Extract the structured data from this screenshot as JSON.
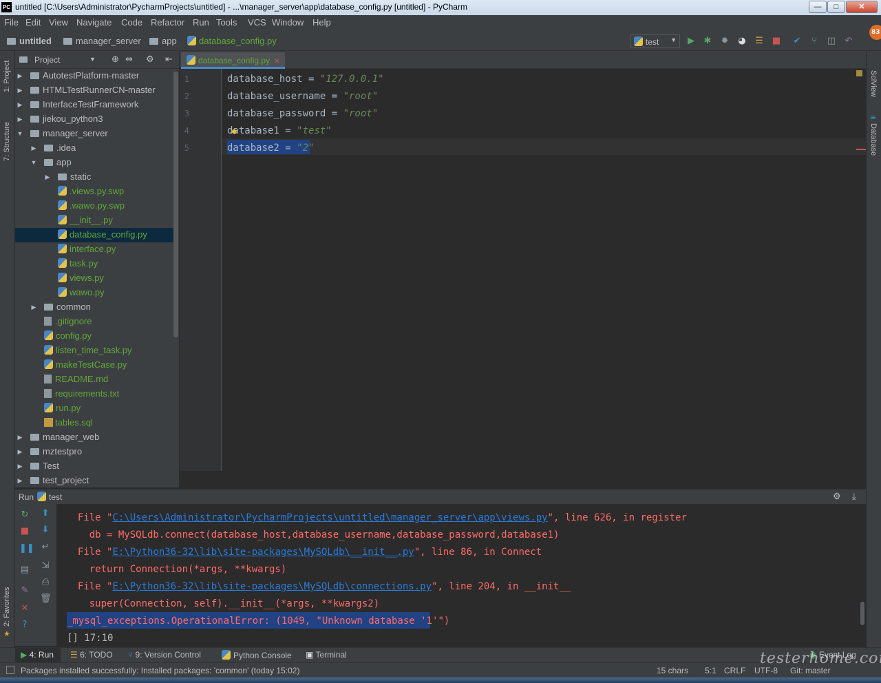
{
  "window": {
    "title": "untitled [C:\\Users\\Administrator\\PycharmProjects\\untitled] - ...\\manager_server\\app\\database_config.py [untitled] - PyCharm",
    "app_icon": "PC"
  },
  "menu": [
    "File",
    "Edit",
    "View",
    "Navigate",
    "Code",
    "Refactor",
    "Run",
    "Tools",
    "VCS",
    "Window",
    "Help"
  ],
  "breadcrumb": [
    "untitled",
    "manager_server",
    "app",
    "database_config.py"
  ],
  "run_config": "test",
  "badge": "83",
  "project_panel": {
    "title": "Project"
  },
  "tree": [
    {
      "label": "AutotestPlatform-master",
      "depth": 0,
      "type": "folder",
      "arrow": "right"
    },
    {
      "label": "HTMLTestRunnerCN-master",
      "depth": 0,
      "type": "folder",
      "arrow": "right"
    },
    {
      "label": "InterfaceTestFramework",
      "depth": 0,
      "type": "folder",
      "arrow": "right"
    },
    {
      "label": "jiekou_python3",
      "depth": 0,
      "type": "folder",
      "arrow": "right"
    },
    {
      "label": "manager_server",
      "depth": 0,
      "type": "folder",
      "arrow": "down"
    },
    {
      "label": ".idea",
      "depth": 1,
      "type": "folder",
      "arrow": "right"
    },
    {
      "label": "app",
      "depth": 1,
      "type": "folder",
      "arrow": "down"
    },
    {
      "label": "static",
      "depth": 2,
      "type": "folder",
      "arrow": "right"
    },
    {
      "label": ".views.py.swp",
      "depth": 2,
      "type": "py",
      "arrow": ""
    },
    {
      "label": ".wawo.py.swp",
      "depth": 2,
      "type": "py",
      "arrow": ""
    },
    {
      "label": "__init__.py",
      "depth": 2,
      "type": "py",
      "arrow": ""
    },
    {
      "label": "database_config.py",
      "depth": 2,
      "type": "py",
      "arrow": "",
      "selected": true
    },
    {
      "label": "interface.py",
      "depth": 2,
      "type": "py",
      "arrow": ""
    },
    {
      "label": "task.py",
      "depth": 2,
      "type": "py",
      "arrow": ""
    },
    {
      "label": "views.py",
      "depth": 2,
      "type": "py",
      "arrow": ""
    },
    {
      "label": "wawo.py",
      "depth": 2,
      "type": "py",
      "arrow": ""
    },
    {
      "label": "common",
      "depth": 1,
      "type": "folder",
      "arrow": "right"
    },
    {
      "label": ".gitignore",
      "depth": 1,
      "type": "file",
      "arrow": ""
    },
    {
      "label": "config.py",
      "depth": 1,
      "type": "py",
      "arrow": ""
    },
    {
      "label": "listen_time_task.py",
      "depth": 1,
      "type": "py",
      "arrow": ""
    },
    {
      "label": "makeTestCase.py",
      "depth": 1,
      "type": "py",
      "arrow": ""
    },
    {
      "label": "README.md",
      "depth": 1,
      "type": "file",
      "arrow": ""
    },
    {
      "label": "requirements.txt",
      "depth": 1,
      "type": "file",
      "arrow": ""
    },
    {
      "label": "run.py",
      "depth": 1,
      "type": "py",
      "arrow": ""
    },
    {
      "label": "tables.sql",
      "depth": 1,
      "type": "sql",
      "arrow": ""
    },
    {
      "label": "manager_web",
      "depth": 0,
      "type": "folder",
      "arrow": "right"
    },
    {
      "label": "mztestpro",
      "depth": 0,
      "type": "folder",
      "arrow": "right"
    },
    {
      "label": "Test",
      "depth": 0,
      "type": "folder",
      "arrow": "right"
    },
    {
      "label": "test_project",
      "depth": 0,
      "type": "folder",
      "arrow": "right"
    }
  ],
  "editor": {
    "tab": "database_config.py",
    "lines": [
      {
        "num": "1",
        "code": "database_host = ",
        "str": "\"127.0.0.1\""
      },
      {
        "num": "2",
        "code": "database_username = ",
        "str": "\"root\""
      },
      {
        "num": "3",
        "code": "database_password = ",
        "str": "\"root\""
      },
      {
        "num": "4",
        "code": "database1 = ",
        "str": "\"test\""
      },
      {
        "num": "5",
        "code": "database2 = ",
        "str": "\"2\""
      }
    ]
  },
  "run_panel": {
    "label": "Run",
    "config": "test",
    "output": [
      {
        "pre": "  File \"",
        "link": "C:\\Users\\Administrator\\PycharmProjects\\untitled\\manager_server\\app\\views.py",
        "post": "\", line 626, in register"
      },
      {
        "pre": "    db = MySQLdb.connect(database_host,database_username,database_password,database1)",
        "link": "",
        "post": ""
      },
      {
        "pre": "  File \"",
        "link": "E:\\Python36-32\\lib\\site-packages\\MySQLdb\\__init__.py",
        "post": "\", line 86, in Connect"
      },
      {
        "pre": "    return Connection(*args, **kwargs)",
        "link": "",
        "post": ""
      },
      {
        "pre": "  File \"",
        "link": "E:\\Python36-32\\lib\\site-packages\\MySQLdb\\connections.py",
        "post": "\", line 204, in __init__"
      },
      {
        "pre": "    super(Connection, self).__init__(*args, **kwargs2)",
        "link": "",
        "post": ""
      },
      {
        "pre": "_mysql_exceptions.OperationalError: (1049, \"Unknown database '1'\")",
        "link": "",
        "post": ""
      },
      {
        "pre": "[] 17:10",
        "link": "",
        "post": ""
      }
    ]
  },
  "bottom_tabs": [
    "4: Run",
    "6: TODO",
    "9: Version Control",
    "Python Console",
    "Terminal"
  ],
  "event_log": "Event Log",
  "side_labels": {
    "project": "1: Project",
    "structure": "7: Structure",
    "favorites": "2: Favorites",
    "sciview": "SciView",
    "database": "Database"
  },
  "status": {
    "message": "Packages installed successfully: Installed packages: 'common' (today 15:02)",
    "chars": "15 chars",
    "position": "5:1",
    "line_sep": "CRLF",
    "encoding": "UTF-8",
    "vcs": "Git: master"
  },
  "watermark": "testerhome.com"
}
